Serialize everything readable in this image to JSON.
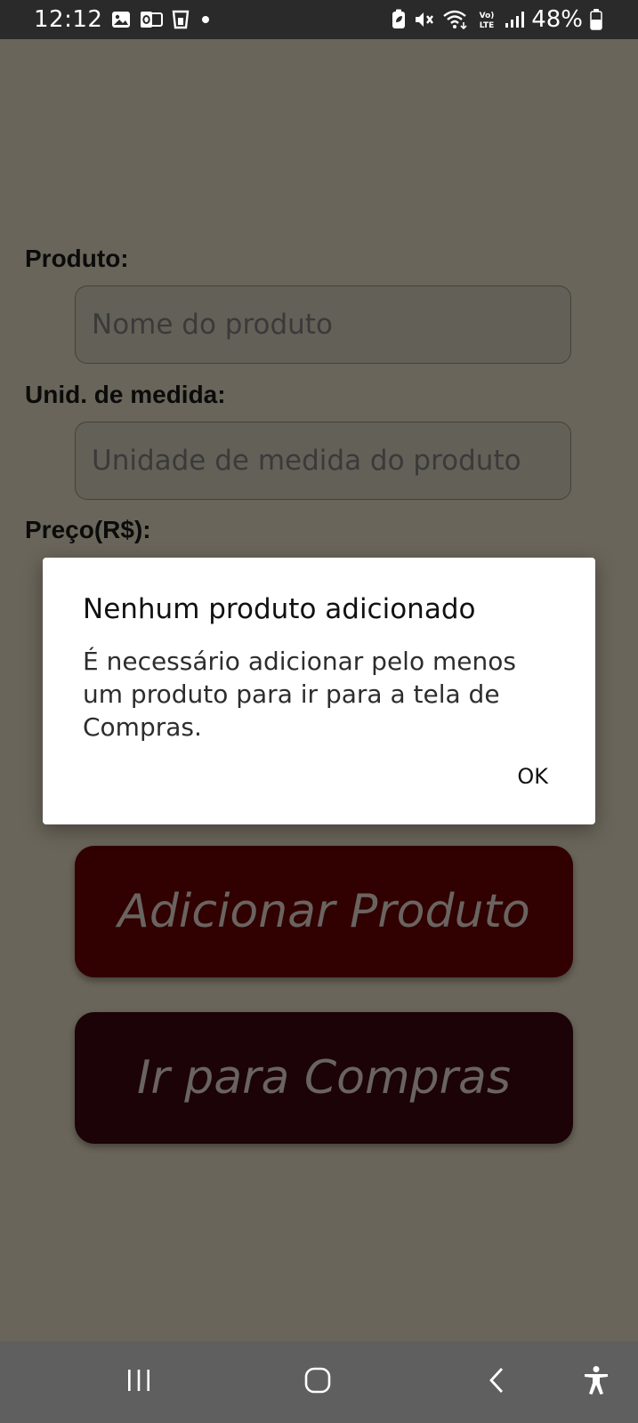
{
  "status_bar": {
    "time": "12:12",
    "left_icons": [
      "gallery-icon",
      "outlook-icon",
      "glass-icon",
      "dot-icon"
    ],
    "right_icons": [
      "battery-saver-icon",
      "mute-icon",
      "wifi-icon",
      "volte-icon",
      "signal-icon"
    ],
    "battery_percent": "48%"
  },
  "form": {
    "product_label": "Produto:",
    "product_placeholder": "Nome do produto",
    "unit_label": "Unid. de medida:",
    "unit_placeholder": "Unidade de medida do produto",
    "price_label": "Preço(R$):"
  },
  "buttons": {
    "add_product": "Adicionar Produto",
    "go_to_purchases": "Ir para Compras"
  },
  "dialog": {
    "title": "Nenhum produto adicionado",
    "message": "É necessário adicionar pelo menos um produto para ir para a tela de Compras.",
    "ok_label": "OK"
  },
  "nav_bar": {
    "buttons": [
      "recents-icon",
      "home-icon",
      "back-icon",
      "accessibility-icon"
    ]
  },
  "colors": {
    "scrim_background": "#6a655a",
    "add_button": "#310001",
    "go_button": "#1b0307",
    "dialog_background": "#ffffff",
    "status_bar": "#2a2a2a",
    "nav_bar": "#5f5f5f"
  }
}
